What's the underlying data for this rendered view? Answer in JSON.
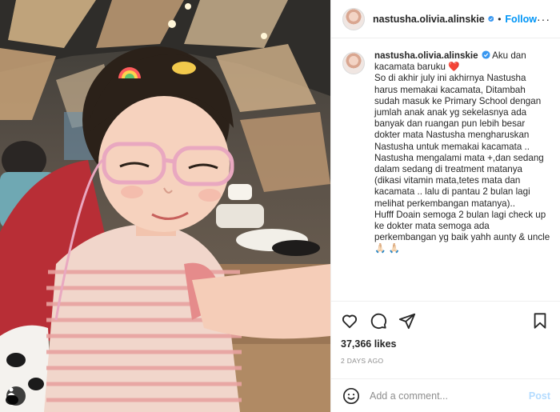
{
  "post": {
    "username": "nastusha.olivia.alinskie",
    "follow_label": "Follow",
    "separator": "•",
    "more_label": "···",
    "caption_username": "nastusha.olivia.alinskie",
    "caption_text": "Aku dan kacamata baruku",
    "caption_emoji": "❤️",
    "caption_body": "So di akhir july ini akhirnya Nastusha harus memakai kacamata, Ditambah sudah masuk ke Primary School dengan jumlah anak anak yg sekelasnya ada banyak dan ruangan pun lebih besar dokter mata Nastusha mengharuskan Nastusha untuk memakai kacamata ..\nNastusha mengalami mata +,dan sedang dalam sedang di treatment matanya (dikasi vitamin mata,tetes mata dan kacamata .. lalu di pantau 2 bulan lagi melihat perkembangan matanya)..\nHufff Doain semoga 2 bulan lagi check up ke dokter mata semoga ada perkembangan yg baik yahh aunty & uncle 🙏🏻 🙏🏻",
    "likes": "37,366 likes",
    "date": "2 DAYS AGO"
  },
  "comment": {
    "placeholder": "Add a comment...",
    "post_label": "Post"
  },
  "icons": {
    "like": "heart-icon",
    "comment": "comment-icon",
    "share": "share-icon",
    "save": "bookmark-icon",
    "emoji": "emoji-icon",
    "verified": "verified-badge-icon",
    "tagged_user": "user-tag-icon"
  },
  "colors": {
    "follow": "#0095f6",
    "post_disabled": "#b3dbff",
    "verified": "#3897f0",
    "muted": "#8e8e8e",
    "border": "#efefef"
  }
}
